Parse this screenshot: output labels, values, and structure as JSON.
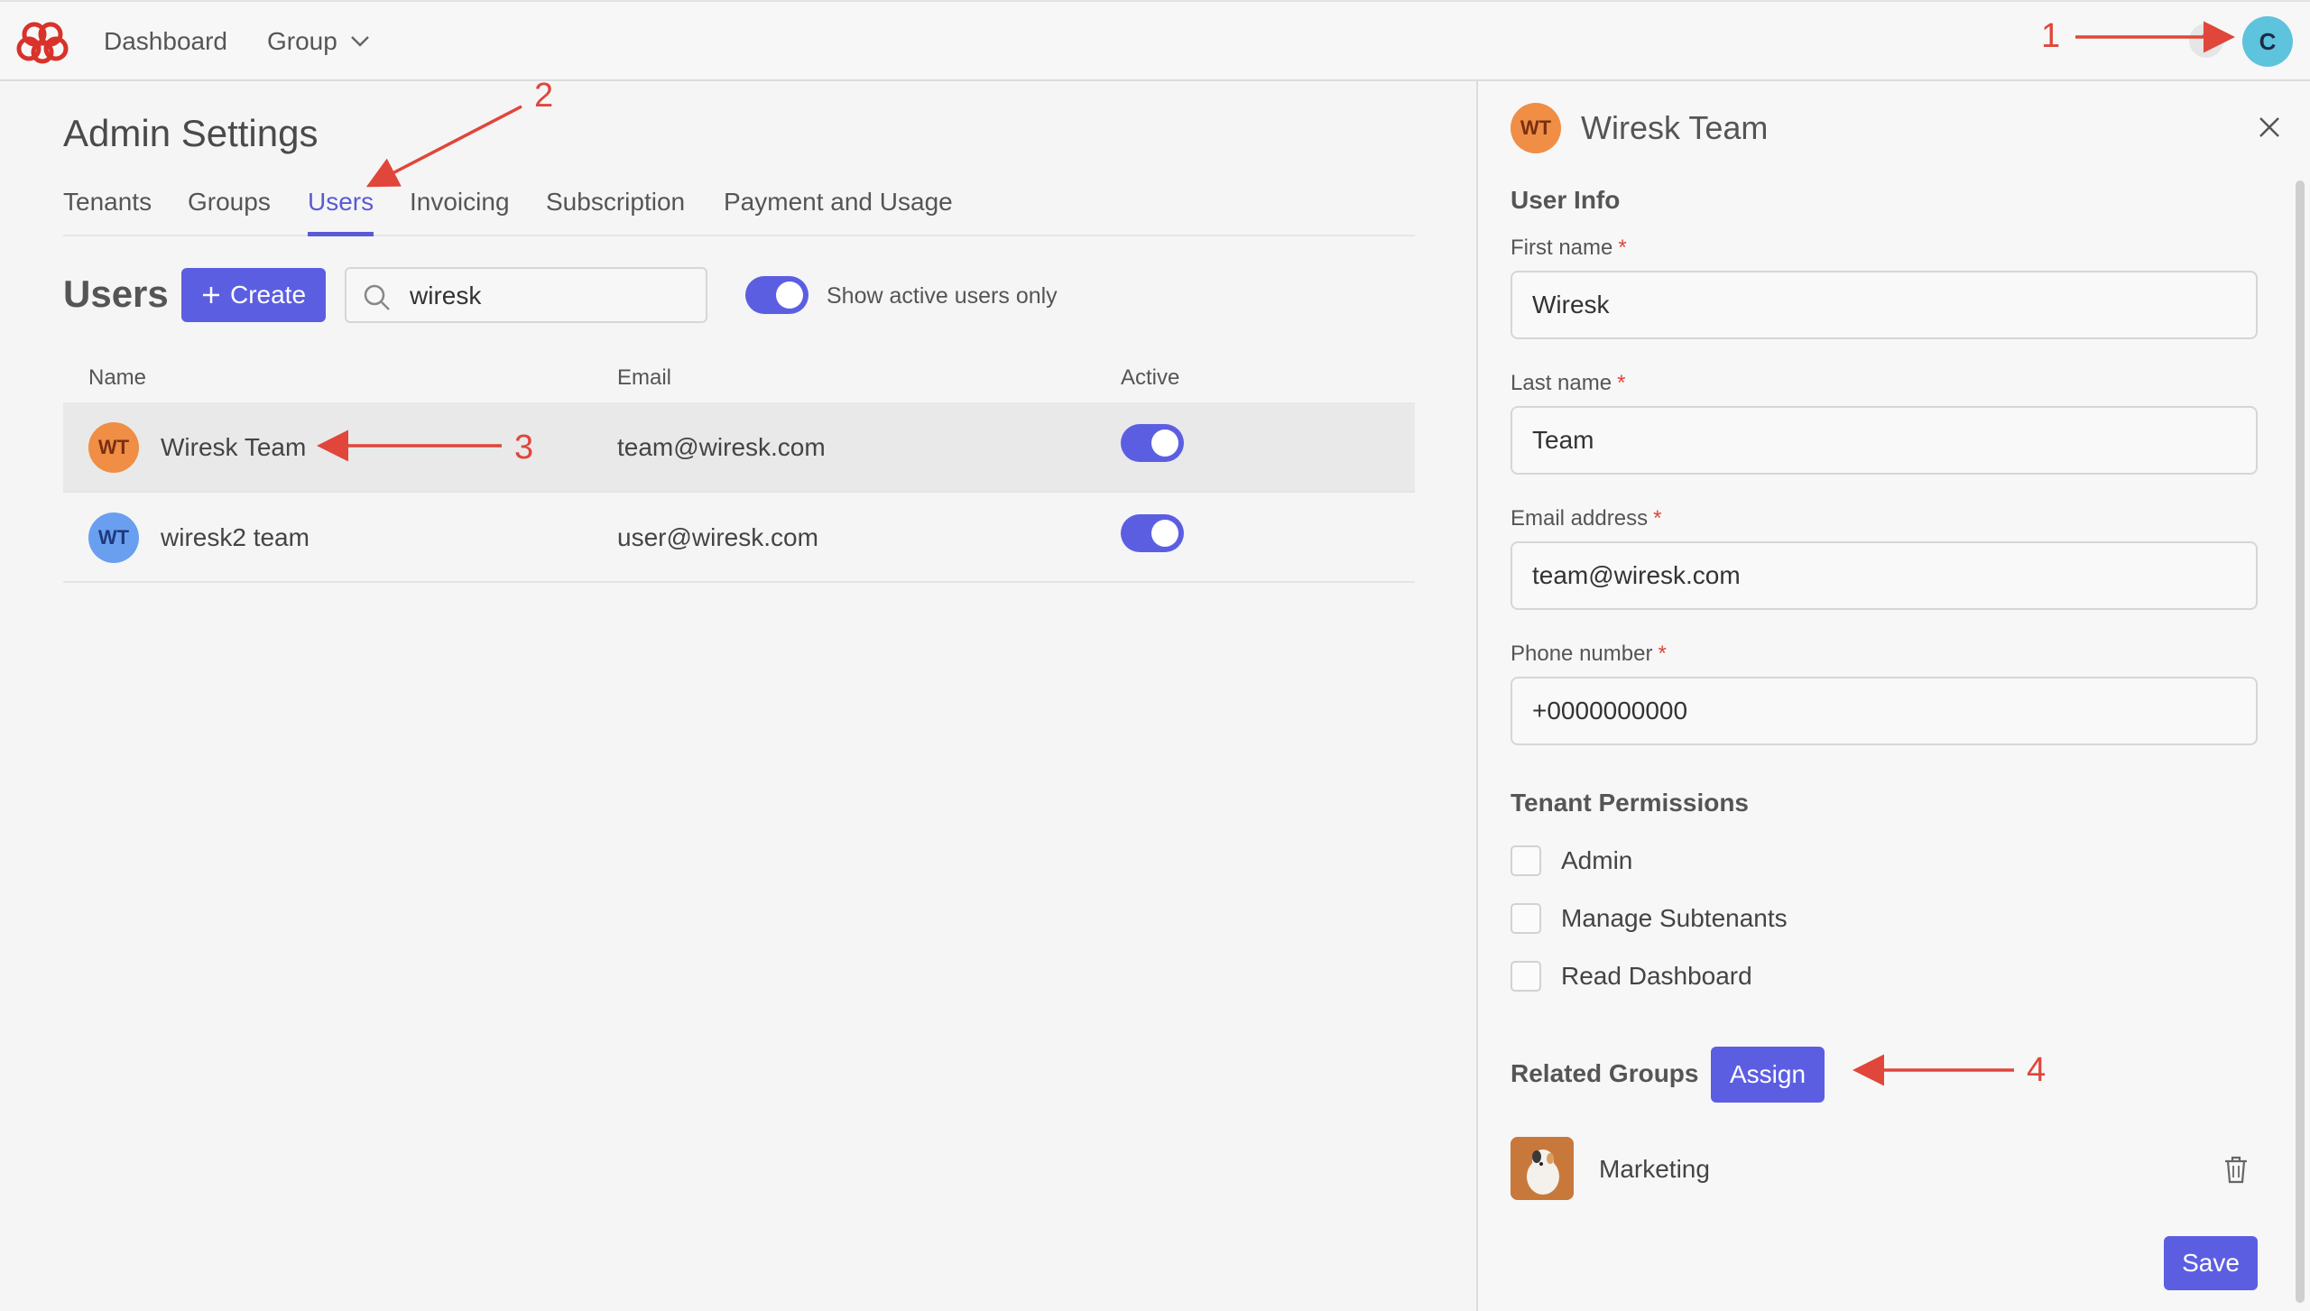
{
  "topbar": {
    "nav": {
      "dashboard": "Dashboard",
      "group": "Group"
    },
    "help_glyph": "?",
    "user_avatar_initial": "C",
    "icons": [
      "app-logo-icon",
      "chevron-down-icon",
      "help-icon"
    ]
  },
  "main": {
    "page_title": "Admin Settings",
    "tabs": [
      {
        "label": "Tenants",
        "active": false
      },
      {
        "label": "Groups",
        "active": false
      },
      {
        "label": "Users",
        "active": true
      },
      {
        "label": "Invoicing",
        "active": false
      },
      {
        "label": "Subscription",
        "active": false
      },
      {
        "label": "Payment and Usage",
        "active": false
      }
    ],
    "users_heading": "Users",
    "create_label": "Create",
    "search": {
      "value": "wiresk"
    },
    "show_active_only": {
      "label": "Show active users only",
      "on": true
    },
    "table": {
      "columns": [
        "Name",
        "Email",
        "Active"
      ],
      "rows": [
        {
          "initials": "WT",
          "name": "Wiresk Team",
          "email": "team@wiresk.com",
          "active": true,
          "selected": true,
          "avatar_color": "#ef8e44"
        },
        {
          "initials": "WT",
          "name": "wiresk2 team",
          "email": "user@wiresk.com",
          "active": true,
          "selected": false,
          "avatar_color": "#6a9ff0"
        }
      ]
    }
  },
  "drawer": {
    "avatar_initials": "WT",
    "title": "Wiresk Team",
    "user_info_title": "User Info",
    "fields": {
      "first_name": {
        "label": "First name",
        "value": "Wiresk"
      },
      "last_name": {
        "label": "Last name",
        "value": "Team"
      },
      "email": {
        "label": "Email address",
        "value": "team@wiresk.com"
      },
      "phone": {
        "label": "Phone number",
        "value": "+0000000000"
      }
    },
    "required_mark": "*",
    "tenant_permissions_title": "Tenant Permissions",
    "permissions": [
      {
        "label": "Admin",
        "checked": false
      },
      {
        "label": "Manage Subtenants",
        "checked": false
      },
      {
        "label": "Read Dashboard",
        "checked": false
      }
    ],
    "related_groups_title": "Related Groups",
    "assign_label": "Assign",
    "groups": [
      {
        "name": "Marketing"
      }
    ],
    "save_label": "Save"
  },
  "annotations": [
    "1",
    "2",
    "3",
    "4"
  ],
  "colors": {
    "accent": "#5c5ee2",
    "annotation": "#e0463a",
    "required": "#e0463a"
  }
}
